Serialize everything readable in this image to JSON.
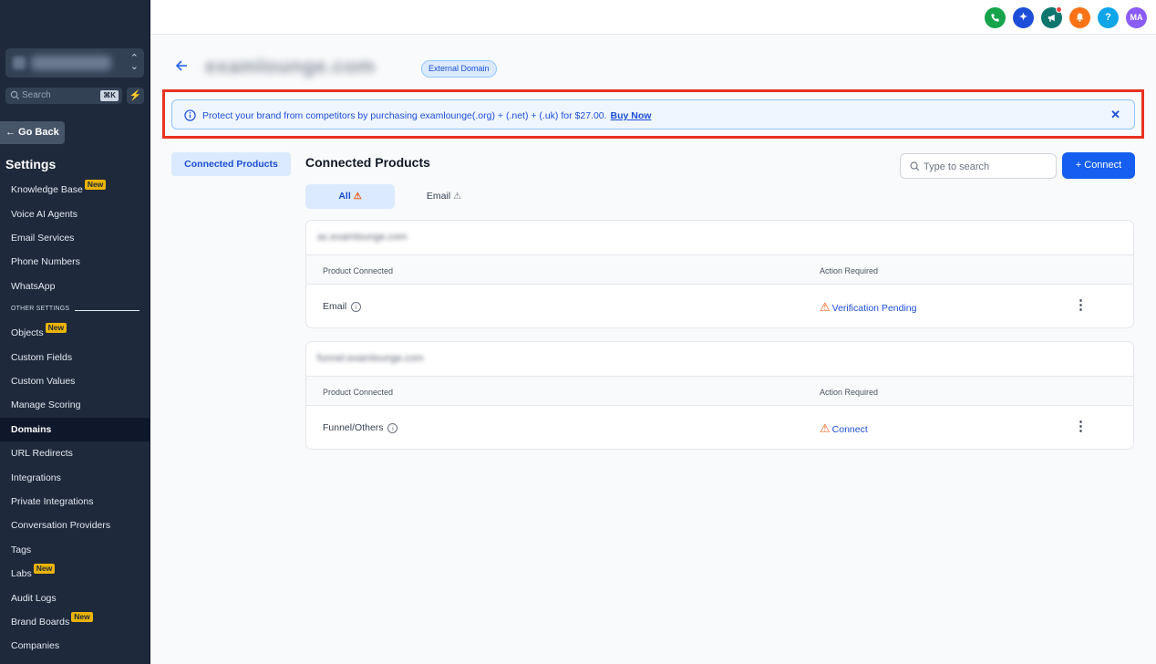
{
  "sidebar": {
    "search_placeholder": "Search",
    "search_shortcut": "⌘K",
    "go_back": "← Go Back",
    "settings_title": "Settings",
    "new_badge": "New",
    "other_settings": "OTHER SETTINGS",
    "items": [
      {
        "label": "Knowledge Base",
        "new": true
      },
      {
        "label": "Voice AI Agents",
        "new": false
      },
      {
        "label": "Email Services",
        "new": false
      },
      {
        "label": "Phone Numbers",
        "new": false
      },
      {
        "label": "WhatsApp",
        "new": false
      },
      {
        "label": "Objects",
        "new": true
      },
      {
        "label": "Custom Fields",
        "new": false
      },
      {
        "label": "Custom Values",
        "new": false
      },
      {
        "label": "Manage Scoring",
        "new": false
      },
      {
        "label": "Domains",
        "new": false,
        "active": true
      },
      {
        "label": "URL Redirects",
        "new": false
      },
      {
        "label": "Integrations",
        "new": false
      },
      {
        "label": "Private Integrations",
        "new": false
      },
      {
        "label": "Conversation Providers",
        "new": false
      },
      {
        "label": "Tags",
        "new": false
      },
      {
        "label": "Labs",
        "new": true
      },
      {
        "label": "Audit Logs",
        "new": false
      },
      {
        "label": "Brand Boards",
        "new": true
      },
      {
        "label": "Companies",
        "new": false
      }
    ]
  },
  "topbar": {
    "icons": [
      "phone-icon",
      "sparkle-icon",
      "megaphone-icon",
      "bell-icon",
      "help-icon"
    ],
    "help_label": "?",
    "avatar_initials": "MA"
  },
  "header": {
    "domain": "examlounge.com",
    "badge": "External Domain"
  },
  "banner": {
    "message": "Protect your brand from competitors by purchasing examlounge(.org) + (.net) + (.uk) for $27.00.",
    "link": "Buy Now",
    "close": "✕"
  },
  "side_tab": "Connected Products",
  "main": {
    "title": "Connected Products",
    "search_placeholder": "Type to search",
    "connect_button": "+  Connect",
    "filters": [
      {
        "label": "All",
        "warn": "⚠"
      },
      {
        "label": "Email",
        "warn": "⚠"
      }
    ],
    "column_product": "Product Connected",
    "column_action": "Action Required",
    "cards": [
      {
        "subdomain": "ac.examlounge.com",
        "product": "Email",
        "action": "Verification Pending"
      },
      {
        "subdomain": "funnel.examlounge.com",
        "product": "Funnel/Others",
        "action": "Connect"
      }
    ]
  },
  "colors": {
    "sidebar_bg": "#1e293b",
    "accent": "#155eef",
    "warning": "#ea580c",
    "highlight_border": "#e8321f"
  }
}
